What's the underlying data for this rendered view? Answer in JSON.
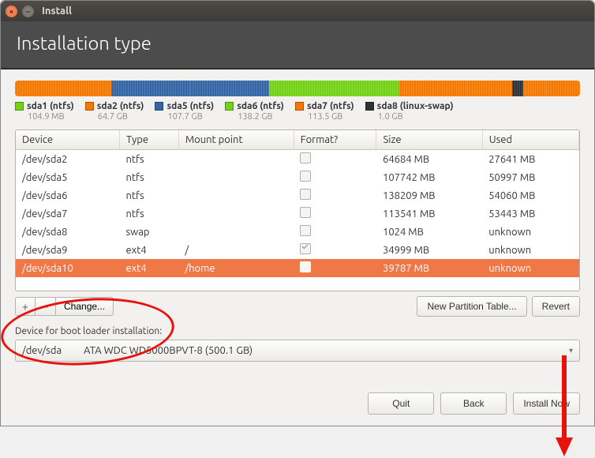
{
  "window": {
    "title": "Install"
  },
  "header": {
    "title": "Installation type"
  },
  "partitions_bar": [
    {
      "colorClass": "c-orange",
      "widthPct": 10
    },
    {
      "colorClass": "c-orange",
      "widthPct": 7
    },
    {
      "colorClass": "c-blue",
      "widthPct": 14
    },
    {
      "colorClass": "c-blue",
      "widthPct": 14
    },
    {
      "colorClass": "c-green",
      "widthPct": 18
    },
    {
      "colorClass": "c-green",
      "widthPct": 5
    },
    {
      "colorClass": "c-orange",
      "widthPct": 12
    },
    {
      "colorClass": "c-orange",
      "widthPct": 8
    },
    {
      "colorClass": "c-black",
      "widthPct": 2
    },
    {
      "colorClass": "c-orange",
      "widthPct": 4
    },
    {
      "colorClass": "c-orange",
      "widthPct": 6
    }
  ],
  "legend": [
    {
      "swatch": "c-green",
      "label": "sda1 (ntfs)",
      "sub": "104.9 MB"
    },
    {
      "swatch": "c-orange",
      "label": "sda2 (ntfs)",
      "sub": "64.7 GB"
    },
    {
      "swatch": "c-blue",
      "label": "sda5 (ntfs)",
      "sub": "107.7 GB"
    },
    {
      "swatch": "c-green",
      "label": "sda6 (ntfs)",
      "sub": "138.2 GB"
    },
    {
      "swatch": "c-orange",
      "label": "sda7 (ntfs)",
      "sub": "113.5 GB"
    },
    {
      "swatch": "c-black",
      "label": "sda8 (linux-swap)",
      "sub": "1.0 GB"
    }
  ],
  "table": {
    "columns": [
      "Device",
      "Type",
      "Mount point",
      "Format?",
      "Size",
      "Used"
    ],
    "rows": [
      {
        "device": "/dev/sda2",
        "type": "ntfs",
        "mount": "",
        "format": false,
        "size": "64684 MB",
        "used": "27641 MB",
        "selected": false
      },
      {
        "device": "/dev/sda5",
        "type": "ntfs",
        "mount": "",
        "format": false,
        "size": "107742 MB",
        "used": "50997 MB",
        "selected": false
      },
      {
        "device": "/dev/sda6",
        "type": "ntfs",
        "mount": "",
        "format": false,
        "size": "138209 MB",
        "used": "54060 MB",
        "selected": false
      },
      {
        "device": "/dev/sda7",
        "type": "ntfs",
        "mount": "",
        "format": false,
        "size": "113541 MB",
        "used": "53443 MB",
        "selected": false
      },
      {
        "device": "/dev/sda8",
        "type": "swap",
        "mount": "",
        "format": false,
        "size": "1024 MB",
        "used": "unknown",
        "selected": false
      },
      {
        "device": "/dev/sda9",
        "type": "ext4",
        "mount": "/",
        "format": true,
        "size": "34999 MB",
        "used": "unknown",
        "selected": false
      },
      {
        "device": "/dev/sda10",
        "type": "ext4",
        "mount": "/home",
        "format": true,
        "size": "39787 MB",
        "used": "unknown",
        "selected": true
      }
    ]
  },
  "buttons": {
    "add": "+",
    "remove": "−",
    "change": "Change...",
    "new_part_table": "New Partition Table...",
    "revert": "Revert",
    "quit": "Quit",
    "back": "Back",
    "install_now": "Install Now"
  },
  "bootloader": {
    "label": "Device for boot loader installation:",
    "device": "/dev/sda",
    "desc": "ATA WDC WD5000BPVT-8 (500.1 GB)"
  }
}
